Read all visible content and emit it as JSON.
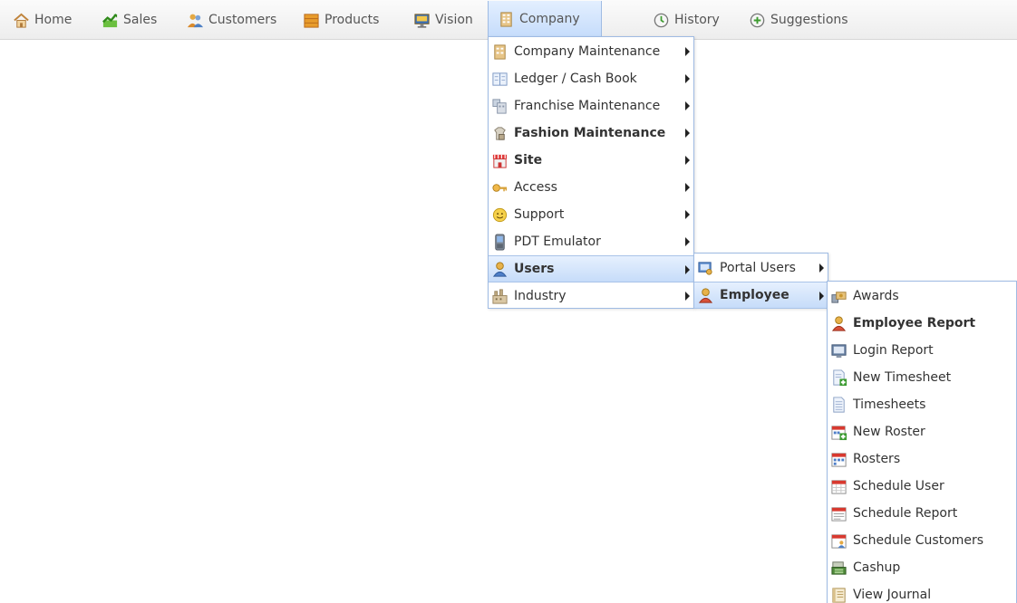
{
  "nav": {
    "items": [
      {
        "label": "Home",
        "icon": "home-icon"
      },
      {
        "label": "Sales",
        "icon": "sales-chart-icon"
      },
      {
        "label": "Customers",
        "icon": "customers-icon"
      },
      {
        "label": "Products",
        "icon": "products-icon"
      },
      {
        "label": "Vision",
        "icon": "vision-monitor-icon"
      },
      {
        "label": "Company",
        "icon": "company-building-icon"
      },
      {
        "label": "History",
        "icon": "history-icon"
      },
      {
        "label": "Suggestions",
        "icon": "suggestions-icon"
      }
    ]
  },
  "company_menu": {
    "items": [
      {
        "label": "Company Maintenance"
      },
      {
        "label": "Ledger / Cash Book"
      },
      {
        "label": "Franchise Maintenance"
      },
      {
        "label": "Fashion Maintenance"
      },
      {
        "label": "Site"
      },
      {
        "label": "Access"
      },
      {
        "label": "Support"
      },
      {
        "label": "PDT Emulator"
      },
      {
        "label": "Users"
      },
      {
        "label": "Industry"
      }
    ]
  },
  "users_menu": {
    "items": [
      {
        "label": "Portal Users"
      },
      {
        "label": "Employee"
      }
    ]
  },
  "employee_menu": {
    "items": [
      {
        "label": "Awards"
      },
      {
        "label": "Employee Report"
      },
      {
        "label": "Login Report"
      },
      {
        "label": "New Timesheet"
      },
      {
        "label": "Timesheets"
      },
      {
        "label": "New Roster"
      },
      {
        "label": "Rosters"
      },
      {
        "label": "Schedule User"
      },
      {
        "label": "Schedule Report"
      },
      {
        "label": "Schedule Customers"
      },
      {
        "label": "Cashup"
      },
      {
        "label": "View Journal"
      }
    ]
  },
  "colors": {
    "menu_border": "#9fbbe3",
    "highlight": "#c6dcf9"
  }
}
